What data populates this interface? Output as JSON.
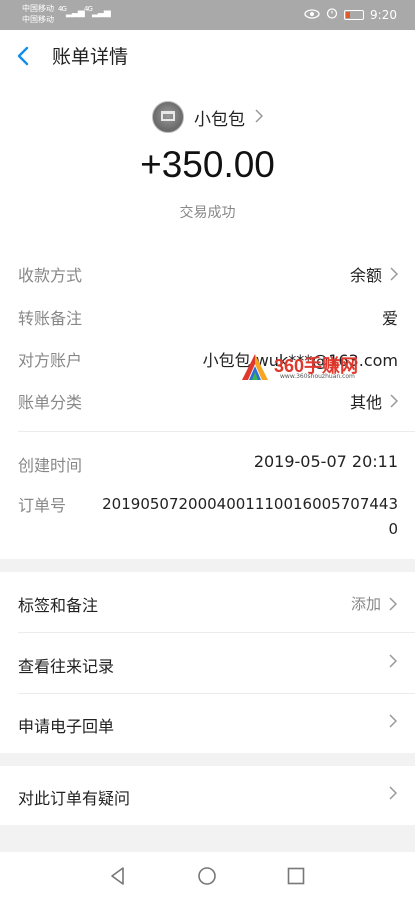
{
  "status_bar": {
    "carrier_1": "中国移动",
    "carrier_2": "中国移动",
    "network_1": "4G",
    "network_2": "4G",
    "time": "9:20"
  },
  "header": {
    "title": "账单详情"
  },
  "payee": {
    "name": "小包包"
  },
  "transaction": {
    "amount": "+350.00",
    "status": "交易成功"
  },
  "details": [
    {
      "label": "收款方式",
      "value": "余额"
    },
    {
      "label": "转账备注",
      "value": "爱"
    },
    {
      "label": "对方账户",
      "value": "小包包 wuk***@163.com"
    },
    {
      "label": "账单分类",
      "value": "其他"
    },
    {
      "label": "创建时间",
      "value": "2019-05-07 20:11"
    },
    {
      "label": "订单号",
      "value": "20190507200040011100160057074430"
    }
  ],
  "watermark": {
    "text": "360手赚网",
    "sub": "www.360shouzhuan.com"
  },
  "actions": [
    {
      "label": "标签和备注",
      "hint": "添加"
    },
    {
      "label": "查看往来记录"
    },
    {
      "label": "申请电子回单"
    }
  ],
  "question": {
    "label": "对此订单有疑问"
  },
  "colors": {
    "accent": "#108ee9",
    "background": "#f2f2f2",
    "status_bar": "#a9a9a9"
  }
}
